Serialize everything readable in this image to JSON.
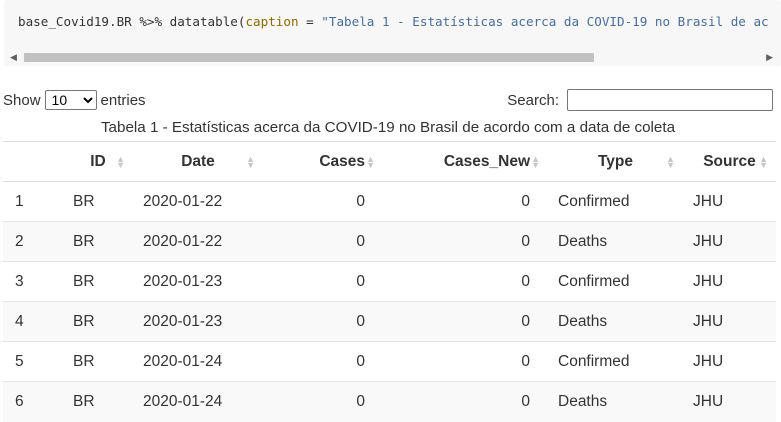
{
  "code": {
    "prefix": "base_Covid19.BR %>% datatable(",
    "arg": "caption",
    "op": " = ",
    "string": "\"Tabela 1 - Estatísticas acerca da COVID-19 no Brasil de ac"
  },
  "controls": {
    "show_label": "Show",
    "length_value": "10",
    "entries_label": "entries",
    "search_label": "Search:",
    "search_value": ""
  },
  "caption": "Tabela 1 - Estatísticas acerca da COVID-19 no Brasil de acordo com a data de coleta",
  "table": {
    "columns": [
      "",
      "ID",
      "Date",
      "Cases",
      "Cases_New",
      "Type",
      "Source"
    ],
    "rows": [
      [
        "1",
        "BR",
        "2020-01-22",
        "0",
        "0",
        "Confirmed",
        "JHU"
      ],
      [
        "2",
        "BR",
        "2020-01-22",
        "0",
        "0",
        "Deaths",
        "JHU"
      ],
      [
        "3",
        "BR",
        "2020-01-23",
        "0",
        "0",
        "Confirmed",
        "JHU"
      ],
      [
        "4",
        "BR",
        "2020-01-23",
        "0",
        "0",
        "Deaths",
        "JHU"
      ],
      [
        "5",
        "BR",
        "2020-01-24",
        "0",
        "0",
        "Confirmed",
        "JHU"
      ],
      [
        "6",
        "BR",
        "2020-01-24",
        "0",
        "0",
        "Deaths",
        "JHU"
      ]
    ]
  },
  "icons": {
    "sort": "sort-both-icon",
    "scroll_left": "chevron-left-icon",
    "scroll_right": "chevron-right-icon"
  }
}
